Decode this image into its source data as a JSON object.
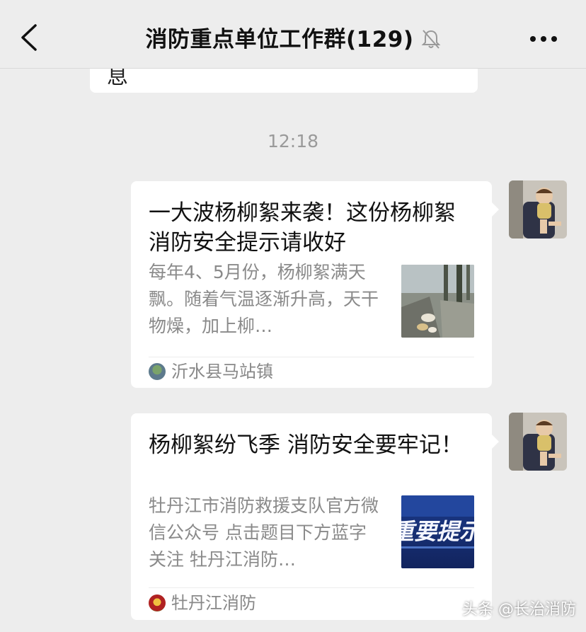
{
  "header": {
    "title": "消防重点单位工作群(129)"
  },
  "previous_message": {
    "text": "息"
  },
  "timestamp": "12:18",
  "messages": [
    {
      "title": "一大波杨柳絮来袭！这份杨柳絮消防安全提示请收好",
      "description": "每年4、5月份，杨柳絮满天飘。随着气温逐渐升高，天干物燥，加上柳…",
      "source": "沂水县马站镇"
    },
    {
      "title": "杨柳絮纷飞季 消防安全要牢记！",
      "description": "牡丹江市消防救援支队官方微信公众号 点击题目下方蓝字关注 牡丹江消防…",
      "source": "牡丹江消防",
      "thumb_text": "重要提示"
    }
  ],
  "watermark": "头条 @长治消防",
  "icons": [
    "back-arrow-icon",
    "mute-bell-icon",
    "more-options-icon"
  ],
  "colors": {
    "background": "#ededed",
    "bubble": "#ffffff",
    "muted_text": "#8a8a8a"
  }
}
